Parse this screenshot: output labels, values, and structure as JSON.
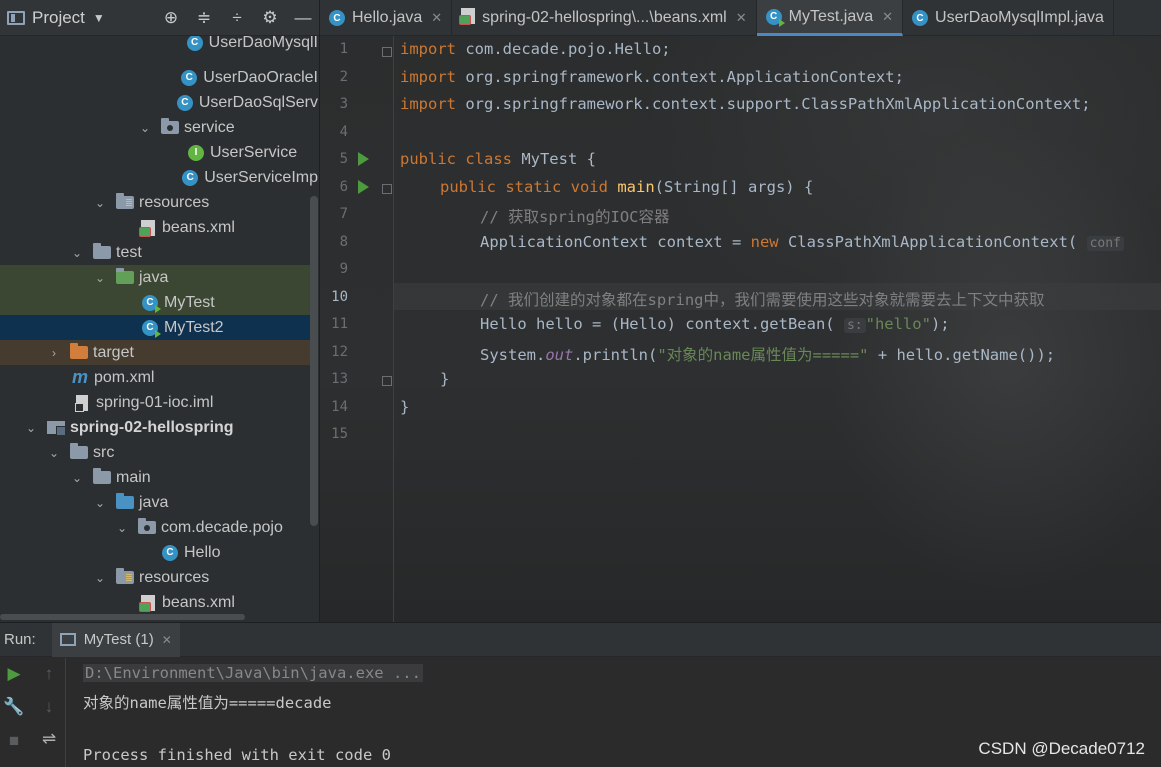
{
  "project": {
    "title": "Project",
    "tree": [
      {
        "label": "UserDaoMysqlI",
        "icon": "class-icon"
      },
      {
        "label": "UserDaoOracleI",
        "icon": "class-icon"
      },
      {
        "label": "UserDaoSqlServ",
        "icon": "class-icon"
      },
      {
        "label": "service",
        "icon": "package-icon"
      },
      {
        "label": "UserService",
        "icon": "interface-icon"
      },
      {
        "label": "UserServiceImp",
        "icon": "class-icon"
      },
      {
        "label": "resources",
        "icon": "resources-folder-icon"
      },
      {
        "label": "beans.xml",
        "icon": "xml-file-icon"
      },
      {
        "label": "test",
        "icon": "folder-icon"
      },
      {
        "label": "java",
        "icon": "test-source-folder-icon"
      },
      {
        "label": "MyTest",
        "icon": "runnable-class-icon"
      },
      {
        "label": "MyTest2",
        "icon": "runnable-class-icon"
      },
      {
        "label": "target",
        "icon": "excluded-folder-icon"
      },
      {
        "label": "pom.xml",
        "icon": "maven-icon"
      },
      {
        "label": "spring-01-ioc.iml",
        "icon": "iml-file-icon"
      },
      {
        "label": "spring-02-hellospring",
        "icon": "module-icon"
      },
      {
        "label": "src",
        "icon": "folder-icon"
      },
      {
        "label": "main",
        "icon": "folder-icon"
      },
      {
        "label": "java",
        "icon": "source-folder-icon"
      },
      {
        "label": "com.decade.pojo",
        "icon": "package-icon"
      },
      {
        "label": "Hello",
        "icon": "class-icon"
      },
      {
        "label": "resources",
        "icon": "resources-folder-icon"
      },
      {
        "label": "beans.xml",
        "icon": "xml-file-icon"
      }
    ]
  },
  "tabs": [
    {
      "label": "Hello.java",
      "icon": "class-icon"
    },
    {
      "label": "spring-02-hellospring\\...\\beans.xml",
      "icon": "xml-file-icon"
    },
    {
      "label": "MyTest.java",
      "icon": "runnable-class-icon",
      "active": true
    },
    {
      "label": "UserDaoMysqlImpl.java",
      "icon": "class-icon"
    }
  ],
  "editor": {
    "current_line": 10,
    "line_numbers": [
      "1",
      "2",
      "3",
      "4",
      "5",
      "6",
      "7",
      "8",
      "9",
      "10",
      "11",
      "12",
      "13",
      "14",
      "15"
    ],
    "code": {
      "l1_kw": "import",
      "l1_rest": " com.decade.pojo.Hello;",
      "l2_kw": "import",
      "l2_rest": " org.springframework.context.ApplicationContext;",
      "l3_kw": "import",
      "l3_rest": " org.springframework.context.support.ClassPathXmlApplicationContext;",
      "l5_kw": "public class",
      "l5_rest": " MyTest {",
      "l6_kw": "public static void",
      "l6_fn": "main",
      "l6_rest": "(String[] args) {",
      "l7_cm": "// 获取spring的IOC容器",
      "l8_a": "ApplicationContext context = ",
      "l8_kw": "new",
      "l8_b": " ClassPathXmlApplicationContext( ",
      "l8_hint": "conf",
      "l10_cm": "// 我们创建的对象都在spring中，我们需要使用这些对象就需要去上下文中获取",
      "l11_a": "Hello hello = (Hello) context.getBean( ",
      "l11_hint": "s:",
      "l11_str": "\"hello\"",
      "l11_b": ");",
      "l12_a": "System.",
      "l12_st": "out",
      "l12_b": ".println(",
      "l12_str": "\"对象的name属性值为=====\"",
      "l12_c": " + hello.getName());",
      "l13": "}",
      "l14": "}"
    }
  },
  "run": {
    "label": "Run:",
    "tab_label": "MyTest (1)",
    "console": {
      "cmd": "D:\\Environment\\Java\\bin\\java.exe ...",
      "output": "对象的name属性值为=====decade",
      "exit": "Process finished with exit code 0"
    }
  },
  "watermark": "CSDN @Decade0712",
  "colors": {
    "keyword": "#cc7832",
    "method": "#ffc66d",
    "comment": "#808080",
    "string": "#6a8759",
    "static_field": "#9876aa",
    "selection": "#0f3150",
    "run_icon": "#4e9a3e"
  }
}
